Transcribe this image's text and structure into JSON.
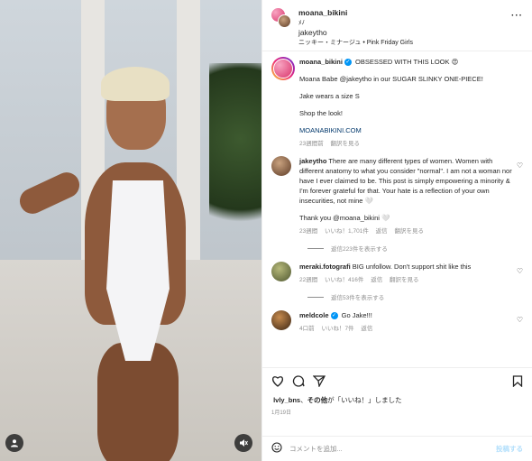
{
  "post": {
    "author": "moana_bikini",
    "collab_line": "ﾒﾉ",
    "collaborator": "jakeytho",
    "audio": "ニッキー・ミナージュ • Pink Friday Girls"
  },
  "comments": [
    {
      "user": "moana_bikini",
      "verified": true,
      "first": "OBSESSED WITH THIS LOOK 😍",
      "paragraphs": [
        "Moana Babe @jakeytho in our SUGAR SLINKY ONE-PIECE!",
        "Jake wears a size S",
        "Shop the look!",
        "MOANABIKINI.COM"
      ],
      "time": "23週間前",
      "translate": "翻訳を見る"
    },
    {
      "user": "jakeytho",
      "text": "There are many different types of women. Women with different anatomy to what you consider \"normal\". I am not a woman nor have I ever claimed to be. This post is simply empowering a minority & I'm forever grateful for that. Your hate is a reflection of your own insecurities, not mine 🤍",
      "reply": "Thank you @moana_bikini 🤍",
      "time": "23週間",
      "likes": "いいね！1,701件",
      "reply_label": "返信",
      "translate": "翻訳を見る",
      "replies_label": "返信223件を表示する"
    },
    {
      "user": "meraki.fotografi",
      "text": "BIG unfollow. Don't support shit like this",
      "time": "22週間",
      "likes": "いいね！416件",
      "reply_label": "返信",
      "translate": "翻訳を見る",
      "replies_label": "返信53件を表示する"
    },
    {
      "user": "meldcole",
      "verified": true,
      "text": "Go Jake!!!",
      "time": "4口前",
      "likes": "いいね！7件",
      "reply_label": "返信"
    }
  ],
  "footer": {
    "likes_user": "lvly_bns",
    "likes_joiner": "、",
    "likes_others": "その他",
    "likes_suffix": "が「いいね！」しました",
    "date": "1月19日",
    "comment_placeholder": "コメントを追加...",
    "post_label": "投稿する"
  },
  "icons": {
    "like": "heart-icon",
    "comment": "comment-icon",
    "share": "share-icon",
    "save": "bookmark-icon",
    "emoji": "emoji-icon",
    "more": "more-icon",
    "mute": "mute-icon",
    "tags": "user-tag-icon"
  },
  "colors": {
    "link": "#00376b",
    "verified": "#0095f6",
    "post_btn": "#b2dffc"
  }
}
